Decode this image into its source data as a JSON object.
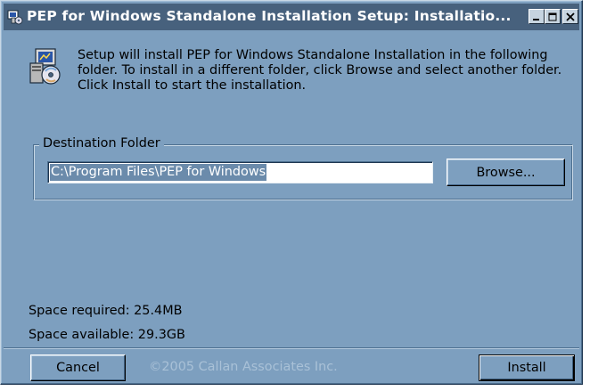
{
  "window": {
    "title": "PEP for Windows Standalone Installation Setup: Installatio...",
    "accent": "#47617d",
    "background": "#7d9fbf"
  },
  "icons": {
    "app": "installer-icon",
    "setup": "setup-disk-icon",
    "minimize": "minimize-icon",
    "maximize": "maximize-icon",
    "close": "close-icon"
  },
  "intro": {
    "text": "Setup will install PEP for Windows Standalone Installation in the following folder. To install in a different folder, click Browse and select another folder. Click Install to start the installation."
  },
  "destination": {
    "label": "Destination Folder",
    "path": "C:\\Program Files\\PEP for Windows",
    "browse_label": "Browse..."
  },
  "space": {
    "required": "Space required: 25.4MB",
    "available": "Space available: 29.3GB"
  },
  "footer": {
    "cancel_label": "Cancel",
    "branding": "©2005 Callan Associates Inc.",
    "install_label": "Install"
  }
}
